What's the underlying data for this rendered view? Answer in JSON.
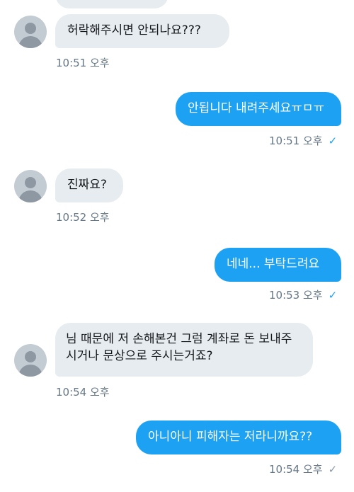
{
  "messages": [
    {
      "dir": "in",
      "text": "허락해주시면 안되나요???",
      "time": "10:51 오후"
    },
    {
      "dir": "out",
      "text": "안됩니다 내려주세요ㅠㅁㅠ",
      "time": "10:51 오후",
      "status": "✓"
    },
    {
      "dir": "in",
      "text": "진짜요?",
      "time": "10:52 오후"
    },
    {
      "dir": "out",
      "text": "네네... 부탁드려요",
      "time": "10:53 오후",
      "status": "✓"
    },
    {
      "dir": "in",
      "text": "님 때문에 저 손해본건 그럼 계좌로 돈 보내주시거나 문상으로 주시는거죠?",
      "time": "10:54 오후"
    },
    {
      "dir": "out",
      "text": "아니아니 피해자는 저라니까요??",
      "time": "10:54 오후",
      "status": "✓"
    }
  ],
  "colors": {
    "outgoing": "#1da1f2",
    "incoming": "#e6ecf0",
    "timestamp": "#657786",
    "avatar": "#c3cbd3"
  },
  "icons": {
    "avatar": "default-profile-icon",
    "delivered": "check-icon"
  }
}
